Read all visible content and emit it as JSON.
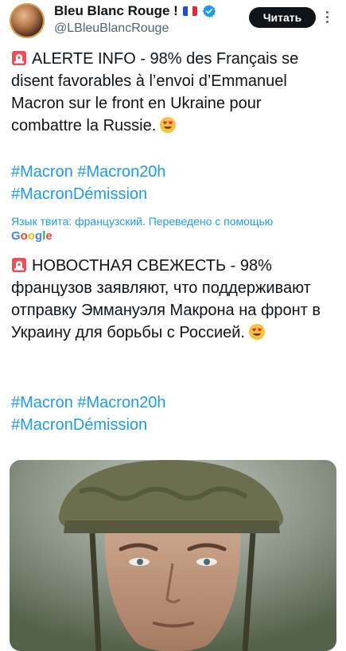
{
  "header": {
    "display_name": "Bleu Blanc Rouge !",
    "handle": "@LBleuBlancRouge",
    "read_button_label": "Читать"
  },
  "original": {
    "text": "ALERTE INFO - 98% des Français se disent favorables à l’envoi d’Emmanuel Macron sur le front en Ukraine pour combattre la Russie.",
    "hashtags_line1": [
      "#Macron",
      "#Macron20h"
    ],
    "hashtags_line2": [
      "#MacronDémission"
    ]
  },
  "translation": {
    "note": "Язык твита: французский. Переведено с помощью",
    "provider": "Google",
    "text": "НОВОСТНАЯ СВЕЖЕСТЬ - 98% французов заявляют, что поддерживают отправку Эммануэля Макрона на фронт в Украину для борьбы с Россией.",
    "hashtags_line1": [
      "#Macron",
      "#Macron20h"
    ],
    "hashtags_line2": [
      "#MacronDémission"
    ]
  },
  "icons": {
    "siren": "police-light-emoji",
    "heart_eyes": "heart-eyes-emoji",
    "verified": "verified-badge-icon",
    "flag": "france-flag"
  },
  "colors": {
    "link": "#1d9bf0",
    "button_bg": "#0f1419",
    "secondary_text": "#536471"
  }
}
